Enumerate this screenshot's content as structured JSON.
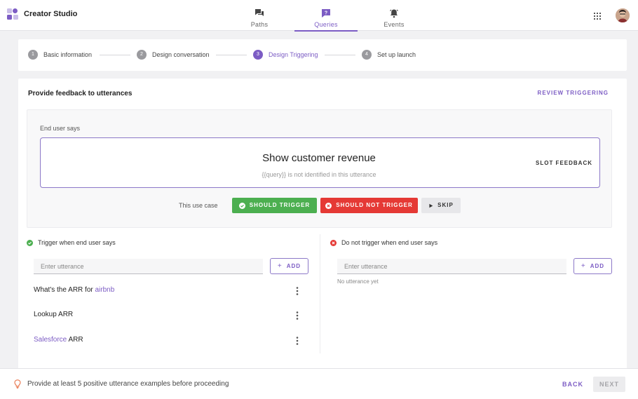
{
  "header": {
    "app_title": "Creator Studio",
    "nav": [
      {
        "label": "Paths",
        "icon": "chat-bubbles-icon",
        "active": false
      },
      {
        "label": "Queries",
        "icon": "question-bubble-icon",
        "active": true
      },
      {
        "label": "Events",
        "icon": "bell-icon",
        "active": false
      }
    ]
  },
  "stepper": {
    "steps": [
      {
        "num": "1",
        "label": "Basic information"
      },
      {
        "num": "2",
        "label": "Design conversation"
      },
      {
        "num": "3",
        "label": "Design Triggering"
      },
      {
        "num": "4",
        "label": "Set up launch"
      }
    ],
    "active_index": 2
  },
  "main": {
    "title": "Provide feedback to utterances",
    "review_label": "REVIEW TRIGGERING",
    "end_user_label": "End user says",
    "utterance": "Show customer revenue",
    "utterance_note": "{{query}} is not identified in this utterance",
    "slot_feedback_label": "SLOT FEEDBACK",
    "use_case_label": "This use case",
    "should_trigger_label": "SHOULD TRIGGER",
    "should_not_trigger_label": "SHOULD NOT TRIGGER",
    "skip_label": "SKIP"
  },
  "trigger": {
    "title": "Trigger when end user says",
    "placeholder": "Enter utterance",
    "add_label": "ADD",
    "items": [
      {
        "prefix": "What's the ARR for ",
        "highlight": "airbnb",
        "suffix": ""
      },
      {
        "prefix": "Lookup ARR",
        "highlight": "",
        "suffix": ""
      },
      {
        "prefix": "",
        "highlight": "Salesforce",
        "suffix": " ARR"
      }
    ]
  },
  "no_trigger": {
    "title": "Do not trigger when end user says",
    "placeholder": "Enter utterance",
    "add_label": "ADD",
    "empty_text": "No utterance yet"
  },
  "footer": {
    "hint": "Provide at least 5 positive utterance examples before proceeding",
    "back_label": "BACK",
    "next_label": "NEXT"
  },
  "colors": {
    "accent": "#7c5cc4",
    "positive": "#4caf50",
    "negative": "#e53935",
    "hint_icon": "#e8734a"
  }
}
